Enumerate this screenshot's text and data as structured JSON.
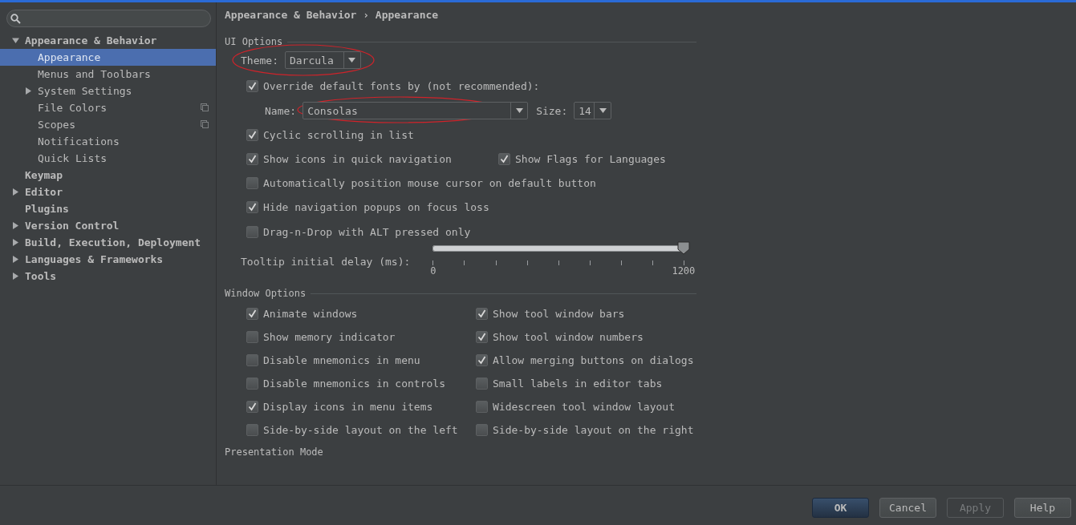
{
  "sidebar": {
    "tree": [
      {
        "label": "Appearance & Behavior",
        "expanded": true,
        "selected": false,
        "children": [
          {
            "label": "Appearance",
            "selected": true
          },
          {
            "label": "Menus and Toolbars",
            "selected": false
          },
          {
            "label": "System Settings",
            "selected": false,
            "expanded": false
          },
          {
            "label": "File Colors",
            "selected": false,
            "kind": "scoped"
          },
          {
            "label": "Scopes",
            "selected": false,
            "kind": "scoped"
          },
          {
            "label": "Notifications",
            "selected": false
          },
          {
            "label": "Quick Lists",
            "selected": false
          }
        ]
      },
      {
        "label": "Keymap",
        "selected": false
      },
      {
        "label": "Editor",
        "selected": false,
        "expanded": false
      },
      {
        "label": "Plugins",
        "selected": false
      },
      {
        "label": "Version Control",
        "selected": false,
        "expanded": false
      },
      {
        "label": "Build, Execution, Deployment",
        "selected": false,
        "expanded": false
      },
      {
        "label": "Languages & Frameworks",
        "selected": false,
        "expanded": false
      },
      {
        "label": "Tools",
        "selected": false,
        "expanded": false
      }
    ]
  },
  "breadcrumb": "Appearance & Behavior › Appearance",
  "ui_options": {
    "title": "UI Options",
    "theme": {
      "label": "Theme:",
      "value": "Darcula",
      "circled": true
    },
    "override": {
      "label": "Override default fonts by (not recommended):",
      "checked": true
    },
    "font_name": {
      "label": "Name:",
      "value": "Consolas",
      "circled": true
    },
    "font_size": {
      "label": "Size:",
      "value": "14"
    },
    "rows": [
      [
        {
          "label": "Cyclic scrolling in list",
          "checked": true
        }
      ],
      [
        {
          "label": "Show icons in quick navigation",
          "checked": true
        },
        {
          "label": "Show Flags for Languages",
          "checked": true
        }
      ],
      [
        {
          "label": "Automatically position mouse cursor on default button",
          "checked": false
        }
      ],
      [
        {
          "label": "Hide navigation popups on focus loss",
          "checked": true
        }
      ],
      [
        {
          "label": "Drag-n-Drop with ALT pressed only",
          "checked": false
        }
      ]
    ],
    "tooltip_delay": {
      "label": "Tooltip initial delay (ms):",
      "level": 1,
      "min": "0",
      "max": "1200"
    }
  },
  "window_options": {
    "title": "Window Options",
    "checkboxes": [
      {
        "label": "Animate windows",
        "checked": true
      },
      {
        "label": "Show tool window bars",
        "checked": true
      },
      {
        "label": "Show memory indicator",
        "checked": false
      },
      {
        "label": "Show tool window numbers",
        "checked": true
      },
      {
        "label": "Disable mnemonics in menu",
        "checked": false
      },
      {
        "label": "Allow merging buttons on dialogs",
        "checked": true
      },
      {
        "label": "Disable mnemonics in controls",
        "checked": false
      },
      {
        "label": "Small labels in editor tabs",
        "checked": false
      },
      {
        "label": "Display icons in menu items",
        "checked": true
      },
      {
        "label": "Widescreen tool window layout",
        "checked": false
      },
      {
        "label": "Side-by-side layout on the left",
        "checked": false
      },
      {
        "label": "Side-by-side layout on the right",
        "checked": false
      }
    ]
  },
  "next_section": {
    "title": "Presentation Mode"
  },
  "buttons": [
    {
      "label": "OK",
      "default": true,
      "disabled": false
    },
    {
      "label": "Cancel",
      "default": false,
      "disabled": false
    },
    {
      "label": "Apply",
      "default": false,
      "disabled": true
    },
    {
      "label": "Help",
      "default": false,
      "disabled": false
    }
  ]
}
